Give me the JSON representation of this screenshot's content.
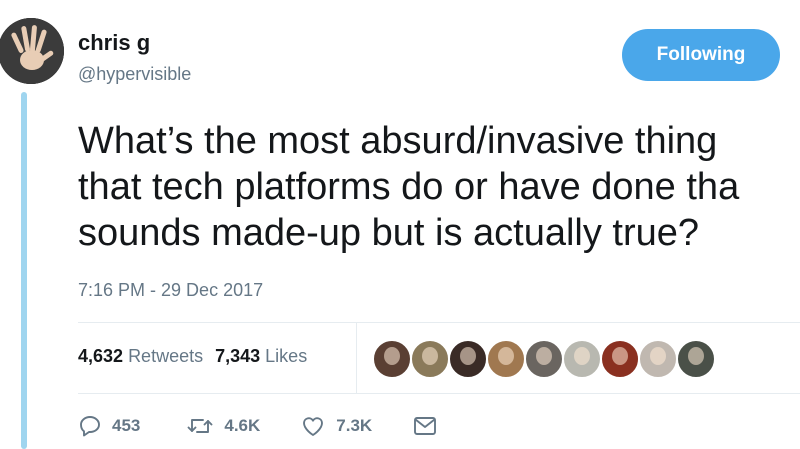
{
  "author": {
    "display_name": "chris g",
    "handle": "@hypervisible",
    "avatar_icon": "hand-avatar"
  },
  "follow_button": {
    "label": "Following",
    "color": "#4aa7ea"
  },
  "tweet": {
    "lines": [
      "What’s the most absurd/invasive thing",
      "that tech platforms do or have done tha",
      "sounds made-up but is actually true?"
    ],
    "timestamp": "7:16 PM - 29 Dec 2017"
  },
  "stats": {
    "retweets_count": "4,632",
    "retweets_label": "Retweets",
    "likes_count": "7,343",
    "likes_label": "Likes"
  },
  "liker_avatars": [
    {
      "color": "#5a3f33"
    },
    {
      "color": "#8a7a5a"
    },
    {
      "color": "#3a2b26"
    },
    {
      "color": "#a07850"
    },
    {
      "color": "#6a6560"
    },
    {
      "color": "#b8b8b0"
    },
    {
      "color": "#8a3020"
    },
    {
      "color": "#c0b8b0"
    },
    {
      "color": "#4a5048"
    }
  ],
  "actions": {
    "replies": "453",
    "retweets": "4.6K",
    "likes": "7.3K"
  },
  "theme": {
    "thread_line": "#9fd5ef",
    "muted_text": "#657786"
  }
}
